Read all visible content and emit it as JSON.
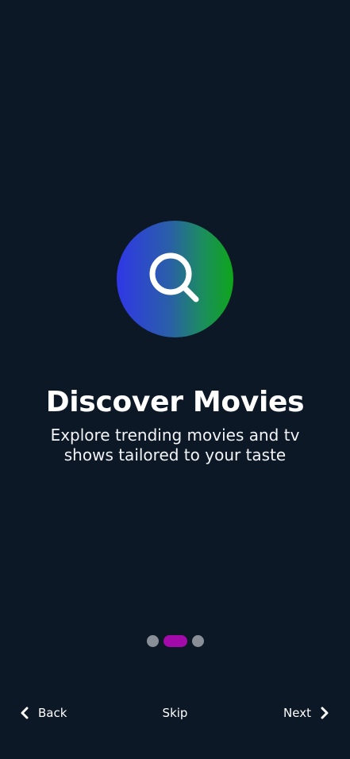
{
  "onboarding": {
    "title": "Discover Movies",
    "subtitle": "Explore trending movies and tv shows tailored to your taste",
    "hero_icon": "search-icon",
    "pager": {
      "total": 3,
      "current": 2
    }
  },
  "nav": {
    "back_label": "Back",
    "skip_label": "Skip",
    "next_label": "Next",
    "back_icon": "chevron-left-icon",
    "next_icon": "chevron-right-icon"
  },
  "colors": {
    "background": "#0d1826",
    "gradient_start": "#2f37e6",
    "gradient_end": "#0ea51a",
    "dot_active": "#a20aa9",
    "dot_inactive": "#8a8f97"
  }
}
